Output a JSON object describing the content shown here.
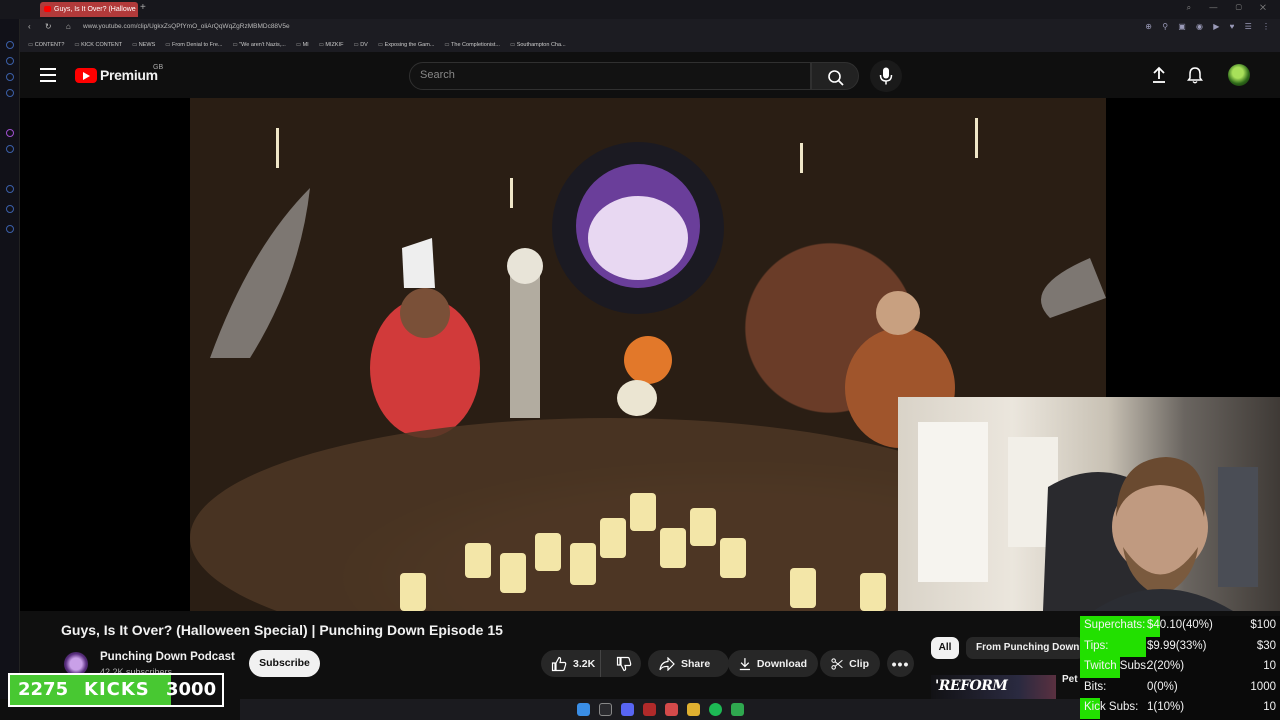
{
  "browser": {
    "tab_title": "Guys, Is It Over? (Hallowe",
    "url": "www.youtube.com/clip/UgkxZsQPfYmO_oliArQqWqZgRzMBMDc88V5e",
    "bookmarks": [
      "CONTENT?",
      "KICK CONTENT",
      "NEWS",
      "From Denial to Fre...",
      "\"We aren't Nazis,...",
      "MI",
      "MIZKIF",
      "DV",
      "Exposing the Gam...",
      "The Completionist...",
      "Southampton Cha..."
    ]
  },
  "youtube": {
    "logo_text": "Premium",
    "country_code": "GB",
    "search_placeholder": "Search"
  },
  "video": {
    "title": "Guys, Is It Over? (Halloween Special) | Punching Down Episode 15",
    "channel_name": "Punching Down Podcast",
    "subscriber_count": "42.2K subscribers",
    "subscribe_label": "Subscribe",
    "likes": "3.2K",
    "share_label": "Share",
    "download_label": "Download",
    "clip_label": "Clip",
    "more_label": "•••"
  },
  "recommendations": {
    "chips": [
      "All",
      "From Punching Down"
    ],
    "thumb_text": "'REFORM",
    "first_title_fragment": "Pet"
  },
  "kicks_goal": {
    "current": "2275",
    "label": "KICKS",
    "goal": "3000",
    "progress": 0.7583
  },
  "stream_stats": [
    {
      "label": "Superchats:",
      "value": "$40.10(40%)",
      "goal": "$100",
      "progress": 0.4
    },
    {
      "label": "Tips:",
      "value": "$9.99(33%)",
      "goal": "$30",
      "progress": 0.33
    },
    {
      "label": "Twitch Subs:",
      "value": "2(20%)",
      "goal": "10",
      "progress": 0.2
    },
    {
      "label": "Bits:",
      "value": "0(0%)",
      "goal": "1000",
      "progress": 0.0
    },
    {
      "label": "Kick Subs:",
      "value": "1(10%)",
      "goal": "10",
      "progress": 0.1
    }
  ],
  "colors": {
    "brand_red": "#ff0000",
    "kicks_green": "#48c832",
    "stat_green": "#22e000",
    "background": "#0f0f0f"
  }
}
